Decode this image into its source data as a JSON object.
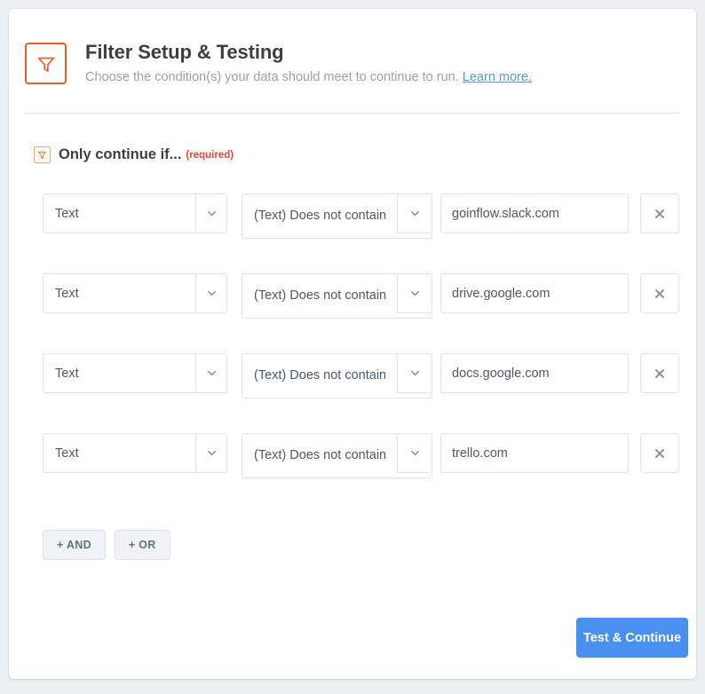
{
  "header": {
    "icon": "funnel-icon",
    "title": "Filter Setup & Testing",
    "subtitle": "Choose the condition(s) your data should meet to continue to run.",
    "link_label": "Learn more."
  },
  "section": {
    "icon": "funnel-icon",
    "label": "Only continue if...",
    "required_tag": "(required)"
  },
  "filters": [
    {
      "field": "Text",
      "condition": "(Text) Does not contain",
      "value": "goinflow.slack.com",
      "remove_icon": "close-icon"
    },
    {
      "field": "Text",
      "condition": "(Text) Does not contain",
      "value": "drive.google.com",
      "remove_icon": "close-icon"
    },
    {
      "field": "Text",
      "condition": "(Text) Does not contain",
      "value": "docs.google.com",
      "remove_icon": "close-icon"
    },
    {
      "field": "Text",
      "condition": "(Text) Does not contain",
      "value": "trello.com",
      "remove_icon": "close-icon"
    }
  ],
  "logic_buttons": {
    "and_label": "+ AND",
    "or_label": "+ OR"
  },
  "footer": {
    "primary_label": "Test & Continue"
  },
  "colors": {
    "accent_orange": "#ef5b26",
    "required_red": "#e8442e",
    "link_blue": "#5a9bd5",
    "primary_blue": "#4a90f0",
    "page_background": "#eceff1",
    "card_background": "#ffffff",
    "border_gray": "#dfe3e6",
    "text_dark": "#3c3f42",
    "text_muted": "#9aa2a8"
  }
}
